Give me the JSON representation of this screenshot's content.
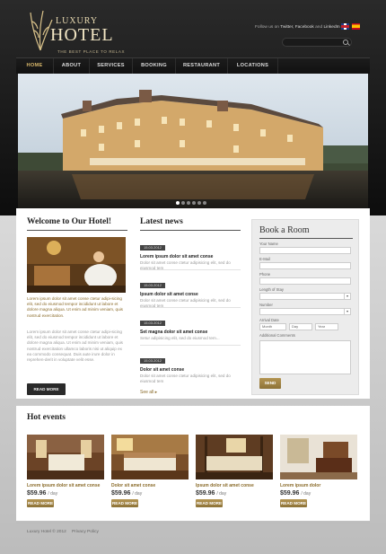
{
  "header": {
    "logo_top": "LUXURY",
    "logo_main": "HOTEL",
    "logo_tagline": "THE BEST PLACE TO RELAX",
    "follow_prefix": "Follow us on",
    "follow_links": "Twitter, Facebook",
    "follow_and": "and",
    "follow_last": "LinkedIn"
  },
  "nav": {
    "items": [
      "HOME",
      "ABOUT",
      "SERVICES",
      "BOOKING",
      "RESTAURANT",
      "LOCATIONS"
    ],
    "active": "HOME"
  },
  "slider": {
    "total": 6,
    "current": 1
  },
  "welcome": {
    "title": "Welcome to Our Hotel!",
    "lead": "Lorem ipsum dolor sit amet conse ctetur adipi-sicing elit, sed do eiusmod tempor incididunt ut labore et dolore magna aliqua. Ut enim ad minim veniam, quis nostrud exercitation.",
    "text": "Lorem ipsum dolor sit amet conse ctetur adipi-sicing elit, sed do eiusmod tempor incididunt ut labore et dolore magna aliqua. Ut enim ad minim veniam, quis nostrud exercitation ullamco laboris nisi ut aliquip ex ea commodo consequat. Duis aute irure dolor in reprehen-derit in voluptate velit esse.",
    "button": "READ MORE"
  },
  "news": {
    "title": "Latest news",
    "items": [
      {
        "date": "15.03.2012",
        "title": "Lorem ipsum dolor sit amet conse",
        "text": "Dolor sit amet conse ctetur adipisicing elit, sed do eiusmod tem"
      },
      {
        "date": "15.03.2012",
        "title": "Ipsum dolor sit amet conse",
        "text": "Dolor sit amet conse ctetur adipisicing elit, sed do eiusmod tem"
      },
      {
        "date": "15.03.2012",
        "title": "Set magna dolor sit amet conse",
        "text": "Setur adipisicing elit, sed do eiusmod tem..."
      },
      {
        "date": "15.03.2012",
        "title": "Dolor sit amet conse",
        "text": "Dolor sit amet conse ctetur adipisicing elit, sed do eiusmod tem"
      }
    ],
    "see_all": "See all"
  },
  "booking": {
    "title": "Book a Room",
    "labels": {
      "name": "Your Name",
      "email": "E-Mail",
      "phone": "Phone",
      "length": "Length of Stay",
      "number": "Number",
      "arrival": "Arrival Date",
      "comments": "Additional Comments"
    },
    "date": {
      "month": "Month",
      "day": "Day",
      "year": "Year"
    },
    "send": "SEND"
  },
  "events": {
    "title": "Hot events",
    "items": [
      {
        "name": "Lorem ipsum dolor sit amet conse",
        "price": "$59.96",
        "unit": "/ day",
        "button": "READ MORE"
      },
      {
        "name": "Dolor sit amet conse",
        "price": "$59.96",
        "unit": "/ day",
        "button": "READ MORE"
      },
      {
        "name": "Ipsum dolor sit amet conse",
        "price": "$59.96",
        "unit": "/ day",
        "button": "READ MORE"
      },
      {
        "name": "Lorem ipsum dolor",
        "price": "$59.96",
        "unit": "/ day",
        "button": "READ MORE"
      }
    ]
  },
  "footer": {
    "copyright": "Luxury Hotel © 2012",
    "privacy": "Privacy Policy"
  },
  "colors": {
    "accent": "#8a6b2a",
    "gold_button": "#a88a47",
    "nav_active": "#d8b76a",
    "dark": "#1c1c1c"
  }
}
